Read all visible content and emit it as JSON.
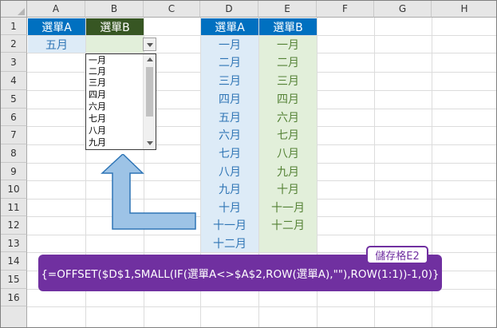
{
  "columns": [
    "A",
    "B",
    "C",
    "D",
    "E",
    "F",
    "G",
    "H"
  ],
  "rows": [
    "1",
    "2",
    "3",
    "4",
    "5",
    "6",
    "7",
    "8",
    "9",
    "10",
    "11",
    "12",
    "13",
    "14",
    "15",
    "16"
  ],
  "cells": {
    "A1": "選單A",
    "B1": "選單B",
    "A2": "五月",
    "D1": "選單A",
    "E1": "選單B"
  },
  "column_d_values": [
    "一月",
    "二月",
    "三月",
    "四月",
    "五月",
    "六月",
    "七月",
    "八月",
    "九月",
    "十月",
    "十一月",
    "十二月"
  ],
  "column_e_values": [
    "一月",
    "二月",
    "三月",
    "四月",
    "六月",
    "七月",
    "八月",
    "九月",
    "十月",
    "十一月",
    "十二月"
  ],
  "dropdown": {
    "items": [
      "一月",
      "二月",
      "三月",
      "四月",
      "六月",
      "七月",
      "八月",
      "九月"
    ]
  },
  "annotation": {
    "badge": "儲存格E2",
    "formula": "{=OFFSET($D$1,SMALL(IF(選單A<>$A$2,ROW(選單A),\"\"),ROW(1:1))-1,0)}"
  },
  "colors": {
    "header_blue": "#0070c0",
    "header_green": "#375623",
    "light_blue": "#ddebf7",
    "light_green": "#e2efda",
    "formula_purple": "#7030a0",
    "arrow_fill": "#9dc3e6",
    "arrow_stroke": "#2e75b6"
  },
  "icons": {
    "dropdown": "chevron-down-icon",
    "arrow": "bent-up-arrow-icon"
  }
}
